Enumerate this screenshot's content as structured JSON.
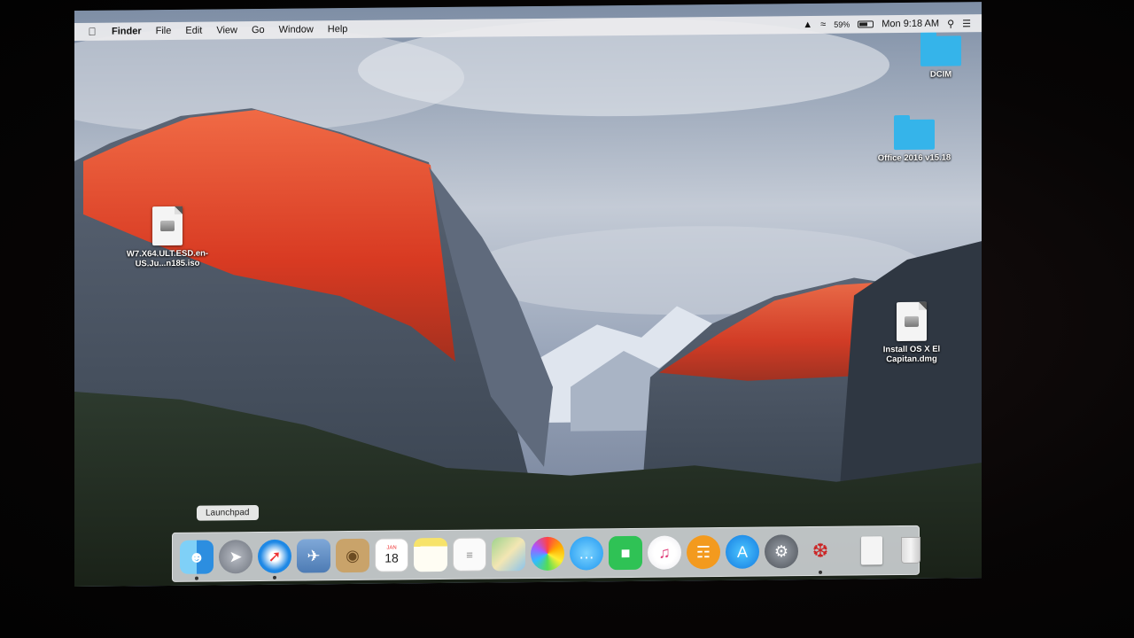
{
  "menubar": {
    "apple_icon": "apple-icon",
    "app_name": "Finder",
    "menus": [
      "File",
      "Edit",
      "View",
      "Go",
      "Window",
      "Help"
    ],
    "battery_percent": "59%",
    "clock": "Mon 9:18 AM"
  },
  "desktop": {
    "icons": [
      {
        "label": "DCIM",
        "kind": "folder"
      },
      {
        "label": "Office 2016 v15.18",
        "kind": "folder"
      },
      {
        "label": "W7.X64.ULT.ESD.en-US.Ju...n185.iso",
        "kind": "disk-image"
      },
      {
        "label": "Install OS X El Capitan.dmg",
        "kind": "disk-image"
      }
    ]
  },
  "dock": {
    "tooltip": "Launchpad",
    "apps": [
      "Finder",
      "Launchpad",
      "Safari",
      "Photo Browser",
      "Contacts",
      "Calendar",
      "Notes",
      "Reminders",
      "Maps",
      "Photos",
      "Messages",
      "FaceTime",
      "iTunes",
      "iBooks",
      "App Store",
      "System Preferences",
      "Flash Player Install Manager",
      "Documents",
      "Trash"
    ],
    "calendar_month": "JAN",
    "calendar_day": "18"
  },
  "colors": {
    "folder": "#35b4ea",
    "menubar": "#ececee",
    "sky": "#8fa3bb",
    "rock_lit": "#e2462a"
  }
}
